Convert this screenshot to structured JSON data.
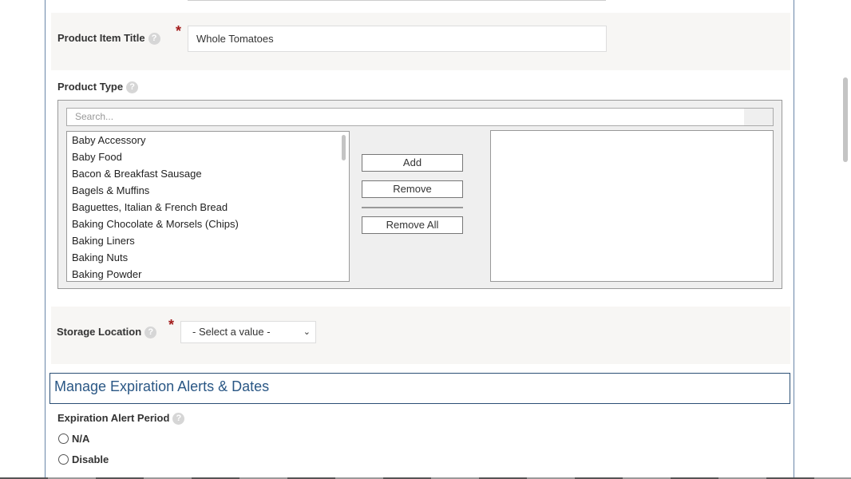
{
  "product_title": {
    "label": "Product Item Title",
    "required": "*",
    "value": "Whole Tomatoes"
  },
  "product_type": {
    "label": "Product Type",
    "search_placeholder": "Search...",
    "available_options": [
      "Baby Accessory",
      "Baby Food",
      "Bacon & Breakfast Sausage",
      "Bagels & Muffins",
      "Baguettes, Italian & French Bread",
      "Baking Chocolate & Morsels (Chips)",
      "Baking Liners",
      "Baking Nuts",
      "Baking Powder"
    ],
    "add_label": "Add",
    "remove_label": "Remove",
    "remove_all_label": "Remove All"
  },
  "storage_location": {
    "label": "Storage Location",
    "required": "*",
    "selected": "- Select a value -"
  },
  "expiration_section": {
    "title": "Manage Expiration Alerts & Dates",
    "alert_period_label": "Expiration Alert Period",
    "options": [
      "N/A",
      "Disable"
    ]
  },
  "icons": {
    "help": "help-question-icon",
    "dropdown": "chevron-down-icon"
  },
  "colors": {
    "required_star": "#a31c1c",
    "section_title": "#2a5785",
    "section_border": "#2b4f75"
  }
}
